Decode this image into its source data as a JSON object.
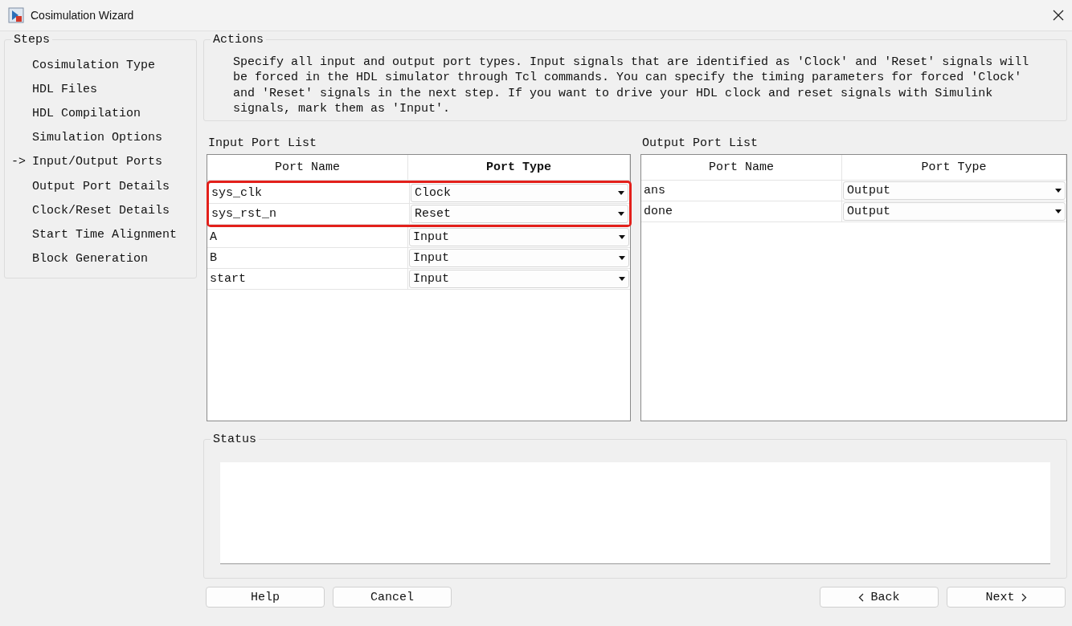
{
  "window": {
    "title": "Cosimulation Wizard"
  },
  "steps": {
    "title": "Steps",
    "marker": "->",
    "items": [
      {
        "label": "Cosimulation Type",
        "selected": false
      },
      {
        "label": "HDL Files",
        "selected": false
      },
      {
        "label": "HDL Compilation",
        "selected": false
      },
      {
        "label": "Simulation Options",
        "selected": false
      },
      {
        "label": "Input/Output Ports",
        "selected": true
      },
      {
        "label": "Output Port Details",
        "selected": false
      },
      {
        "label": "Clock/Reset Details",
        "selected": false
      },
      {
        "label": "Start Time Alignment",
        "selected": false
      },
      {
        "label": "Block Generation",
        "selected": false
      }
    ]
  },
  "actions": {
    "title": "Actions",
    "text": "Specify all input and output port types. Input signals that are identified as 'Clock' and 'Reset' signals will be forced in the HDL simulator through Tcl commands. You can specify the timing parameters for forced 'Clock' and 'Reset' signals in the next step. If you want to drive your HDL clock and reset signals with Simulink signals, mark them as 'Input'."
  },
  "input_ports": {
    "title": "Input Port List",
    "columns": [
      {
        "label": "Port Name",
        "bold": false
      },
      {
        "label": "Port Type",
        "bold": true
      }
    ],
    "rows": [
      {
        "name": "sys_clk",
        "type": "Clock",
        "highlighted": true
      },
      {
        "name": "sys_rst_n",
        "type": "Reset",
        "highlighted": true
      },
      {
        "name": "A",
        "type": "Input",
        "highlighted": false
      },
      {
        "name": "B",
        "type": "Input",
        "highlighted": false
      },
      {
        "name": "start",
        "type": "Input",
        "highlighted": false
      }
    ]
  },
  "output_ports": {
    "title": "Output Port List",
    "columns": [
      {
        "label": "Port Name",
        "bold": false
      },
      {
        "label": "Port Type",
        "bold": false
      }
    ],
    "rows": [
      {
        "name": "ans",
        "type": "Output",
        "highlighted": false
      },
      {
        "name": "done",
        "type": "Output",
        "highlighted": false
      }
    ]
  },
  "status": {
    "title": "Status"
  },
  "buttons": [
    {
      "label": "Help",
      "kind": "plain"
    },
    {
      "label": "Cancel",
      "kind": "plain"
    },
    {
      "label": "Back",
      "kind": "back"
    },
    {
      "label": "Next",
      "kind": "next"
    }
  ]
}
